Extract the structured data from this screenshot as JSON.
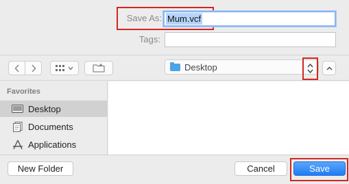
{
  "save_as": {
    "label": "Save As:",
    "value": "Mum.vcf"
  },
  "tags": {
    "label": "Tags:",
    "value": ""
  },
  "toolbar": {
    "back_icon": "chevron-left-icon",
    "forward_icon": "chevron-right-icon",
    "view_icon": "grid-view-icon",
    "new_folder_icon": "new-folder-icon",
    "location": "Desktop",
    "expand_icon": "chevron-up-icon"
  },
  "sidebar": {
    "header": "Favorites",
    "items": [
      {
        "label": "Desktop",
        "icon": "desktop-icon",
        "selected": true
      },
      {
        "label": "Documents",
        "icon": "documents-icon",
        "selected": false
      },
      {
        "label": "Applications",
        "icon": "applications-icon",
        "selected": false
      }
    ]
  },
  "buttons": {
    "new_folder": "New Folder",
    "cancel": "Cancel",
    "save": "Save"
  },
  "colors": {
    "accent": "#1f7cf5",
    "highlight": "#d2261e",
    "selection": "#b4d4fb"
  }
}
